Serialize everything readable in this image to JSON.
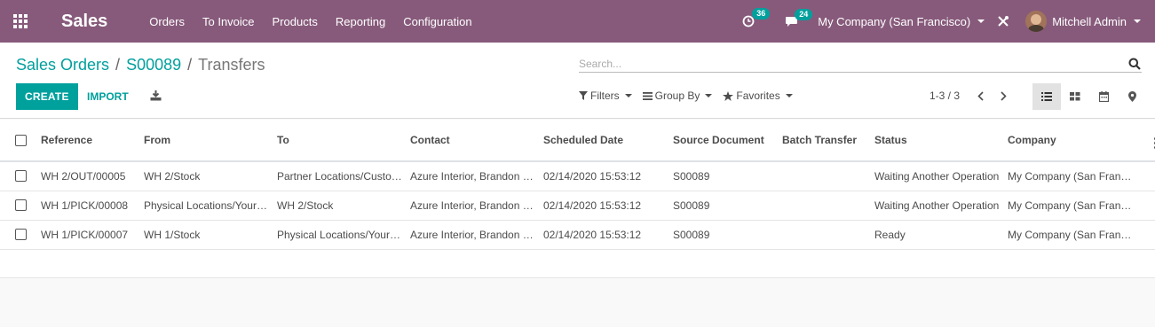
{
  "navbar": {
    "app_name": "Sales",
    "menu": [
      "Orders",
      "To Invoice",
      "Products",
      "Reporting",
      "Configuration"
    ],
    "activity_count": "36",
    "messages_count": "24",
    "company": "My Company (San Francisco)",
    "user": "Mitchell Admin",
    "bar_color": "#875a7b"
  },
  "breadcrumb": {
    "items": [
      "Sales Orders",
      "S00089"
    ],
    "current": "Transfers"
  },
  "search": {
    "placeholder": "Search..."
  },
  "buttons": {
    "create": "CREATE",
    "import": "IMPORT"
  },
  "search_options": {
    "filters": "Filters",
    "group_by": "Group By",
    "favorites": "Favorites"
  },
  "pager": {
    "value": "1-3 / 3"
  },
  "table": {
    "columns": [
      "Reference",
      "From",
      "To",
      "Contact",
      "Scheduled Date",
      "Source Document",
      "Batch Transfer",
      "Status",
      "Company"
    ],
    "rows": [
      [
        "WH 2/OUT/00005",
        "WH 2/Stock",
        "Partner Locations/Customers",
        "Azure Interior, Brandon Freeman",
        "02/14/2020 15:53:12",
        "S00089",
        "",
        "Waiting Another Operation",
        "My Company (San Francisco)"
      ],
      [
        "WH 1/PICK/00008",
        "Physical Locations/YourCompany",
        "WH 2/Stock",
        "Azure Interior, Brandon Freeman",
        "02/14/2020 15:53:12",
        "S00089",
        "",
        "Waiting Another Operation",
        "My Company (San Francisco)"
      ],
      [
        "WH 1/PICK/00007",
        "WH 1/Stock",
        "Physical Locations/YourCompany",
        "Azure Interior, Brandon Freeman",
        "02/14/2020 15:53:12",
        "S00089",
        "",
        "Ready",
        "My Company (San Francisco)"
      ]
    ]
  },
  "colors": {
    "accent": "#00a09d",
    "brand": "#875a7b"
  }
}
